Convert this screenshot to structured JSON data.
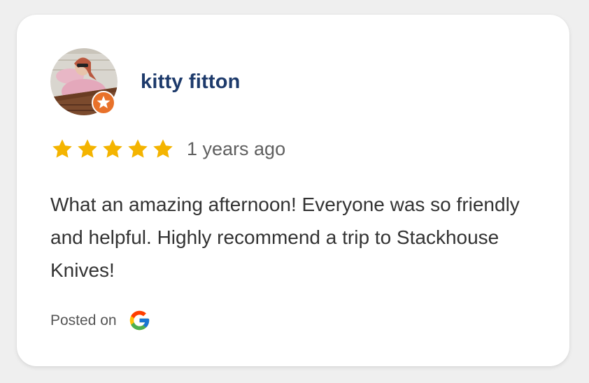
{
  "review": {
    "author_name": "kitty fitton",
    "rating": 5,
    "rating_max": 5,
    "time_ago": "1 years ago",
    "text": "What an amazing afternoon! Everyone was so friendly and helpful. Highly recommend a trip to Stackhouse Knives!",
    "posted_label": "Posted on",
    "source_icon": "google-icon"
  },
  "colors": {
    "name": "#1d3a6b",
    "star": "#f4b400",
    "badge": "#e8712a",
    "background": "#efefef",
    "card": "#ffffff"
  }
}
